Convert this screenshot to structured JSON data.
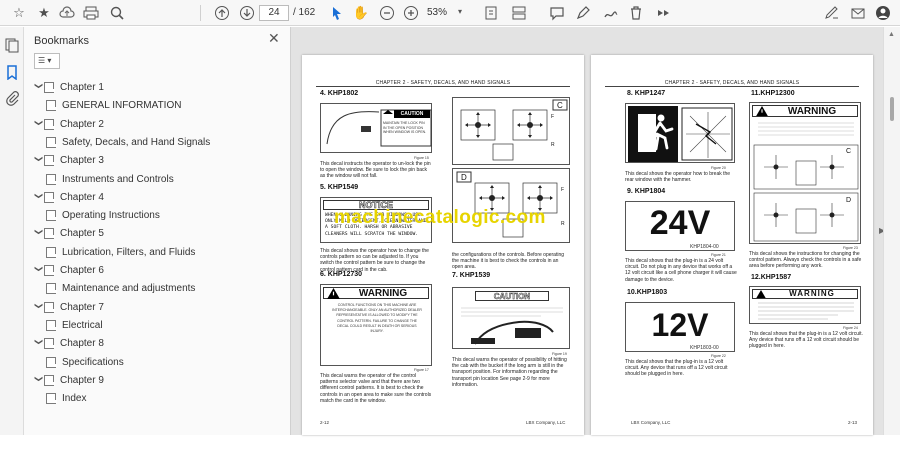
{
  "toolbar": {
    "page_current": "24",
    "page_total": "/ 162",
    "zoom": "53%",
    "zoom_arrow": "▾"
  },
  "bookmarks": {
    "title": "Bookmarks",
    "options_label": "☰ ▾",
    "items": [
      {
        "label": "Chapter 1",
        "level": 0
      },
      {
        "label": "GENERAL INFORMATION",
        "level": 1
      },
      {
        "label": "Chapter 2",
        "level": 0
      },
      {
        "label": "Safety, Decals, and Hand Signals",
        "level": 1
      },
      {
        "label": "Chapter 3",
        "level": 0
      },
      {
        "label": "Instruments and Controls",
        "level": 1
      },
      {
        "label": "Chapter 4",
        "level": 0
      },
      {
        "label": "Operating Instructions",
        "level": 1
      },
      {
        "label": "Chapter 5",
        "level": 0
      },
      {
        "label": "Lubrication, Filters, and Fluids",
        "level": 1
      },
      {
        "label": "Chapter 6",
        "level": 0
      },
      {
        "label": "Maintenance and adjustments",
        "level": 1
      },
      {
        "label": "Chapter 7",
        "level": 0
      },
      {
        "label": "Electrical",
        "level": 1
      },
      {
        "label": "Chapter 8",
        "level": 0
      },
      {
        "label": "Specifications",
        "level": 1
      },
      {
        "label": "Chapter 9",
        "level": 0
      },
      {
        "label": "Index",
        "level": 1
      }
    ]
  },
  "watermark": "machinecatalogic.com",
  "left_page": {
    "header": "CHAPTER 2 - SAFETY, DECALS, AND HAND SIGNALS",
    "s4": "4. KHP1802",
    "s4_fig": "Figure 15",
    "s4_text": "This decal instructs the operator to un-lock the pin to open the window. Be sure to lock the pin back as the window will not fall.",
    "s4_caution": "CAUTION",
    "s4_decal_text": "MAINTAIN THE LOCK PIN IN THE OPEN POSITION WHEN WINDOW IS OPEN.",
    "s5": "5. KHP1549",
    "notice_hdr": "NOTICE",
    "notice_text": "WHEN CLEANING THE CAB WINDOWS, USE ONLY MILD DETERGENT, CLEAN WATER AND A SOFT CLOTH. HARSH OR ABRASIVE CLEANERS WILL SCRATCH THE WINDOW.",
    "s5_text": "This decal shows the operator how to change the controls pattern so can be adjusted to. If you switch the control pattern be sure to change the control pattern card in the cab.",
    "s6": "6. KHP12730",
    "warn_hdr": "WARNING",
    "warn_text": "CONTROL FUNCTIONS ON THIS MACHINE ARE INTERCHANGEABLE. ONLY AN AUTHORIZED DEALER REPRESENTATIVE IS ALLOWED TO MODIFY THE CONTROL PATTERN. FAILURE TO CHANGE THE DECAL COULD RESULT IN DEATH OR SERIOUS INJURY.",
    "s6_fig": "Figure 17",
    "s6_text": "This decal warns the operator of the control patterns selector valve and that there are two different control patterns. It is best to check the controls in an open area to make sure the controls match the card in the window.",
    "s7_text_a": "the configurations of the controls. Before operating the machine it is best to check the controls in an open area.",
    "s7": "7. KHP1539",
    "s7_caution": "CAUTION",
    "s7_fig": "Figure 19",
    "s7_text": "This decal warns the operator of possibility of hitting the cab with the bucket if the long arm is still in the transport position. For information regarding the transport pin location See page 2-9 for more information.",
    "foot_left": "2-12",
    "foot_mid": "LBX Company, LLC"
  },
  "right_page": {
    "header": "CHAPTER 2 - SAFETY, DECALS, AND HAND SIGNALS",
    "s8": "8. KHP1247",
    "s8_fig": "Figure 20",
    "s8_text": "This decal shows the operator how to break the rear window with the hammer.",
    "s9": "9. KHP1804",
    "v24": "24V",
    "v24_code": "KHP1804-00",
    "s9_fig": "Figure 21",
    "s9_text": "This decal shows that the plug-in is a 24 volt circuit. Do not plug in any device that works off a 12 volt circuit like a cell phone charger it will cause damage to the device.",
    "s10": "10.KHP1803",
    "v12": "12V",
    "v12_code": "KHP1803-00",
    "s10_fig": "Figure 22",
    "s10_text": "This decal shows that the plug-in is a 12 volt circuit. Any device that runs off a 12 volt circuit should be plugged in here.",
    "s11": "11.KHP12300",
    "s11_warn": "WARNING",
    "s11_fig": "Figure 23",
    "s11_text": "This decal shows the instructions for changing the control pattern. Always check the controls in a safe area before performing any work.",
    "s12": "12.KHP1587",
    "s12_warn": "WARNING",
    "s12_fig": "Figure 24",
    "s12_text": "This decal shows that the plug-in is a 12 volt circuit. Any device that runs off a 12 volt circuit should be plugged in here.",
    "foot_mid": "LBX Company, LLC",
    "foot_right": "2-13"
  }
}
